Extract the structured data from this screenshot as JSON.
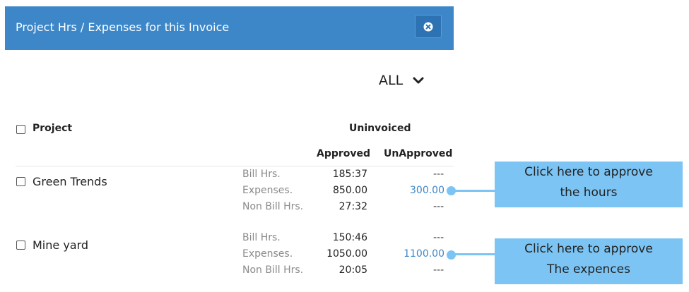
{
  "dialog": {
    "title": "Project Hrs / Expenses for this Invoice"
  },
  "filter": {
    "selected": "ALL"
  },
  "table": {
    "project_header": "Project",
    "group_header": "Uninvoiced",
    "approved_header": "Approved",
    "unapproved_header": "UnApproved",
    "projects": [
      {
        "name": "Green Trends",
        "rows": [
          {
            "label": "Bill Hrs.",
            "approved": "185:37",
            "unapproved": "---"
          },
          {
            "label": "Expenses.",
            "approved": "850.00",
            "unapproved": "300.00"
          },
          {
            "label": "Non Bill Hrs.",
            "approved": "27:32",
            "unapproved": "---"
          }
        ]
      },
      {
        "name": "Mine yard",
        "rows": [
          {
            "label": "Bill Hrs.",
            "approved": "150:46",
            "unapproved": "---"
          },
          {
            "label": "Expenses.",
            "approved": "1050.00",
            "unapproved": "1100.00"
          },
          {
            "label": "Non Bill Hrs.",
            "approved": "20:05",
            "unapproved": "---"
          }
        ]
      }
    ]
  },
  "callouts": [
    {
      "line1": "Click here to approve",
      "line2": "the hours"
    },
    {
      "line1": "Click here to approve",
      "line2": "The expences"
    }
  ],
  "colors": {
    "header_bg": "#3d87c8",
    "link": "#3d87c8",
    "callout_bg": "#7cc4f4"
  }
}
